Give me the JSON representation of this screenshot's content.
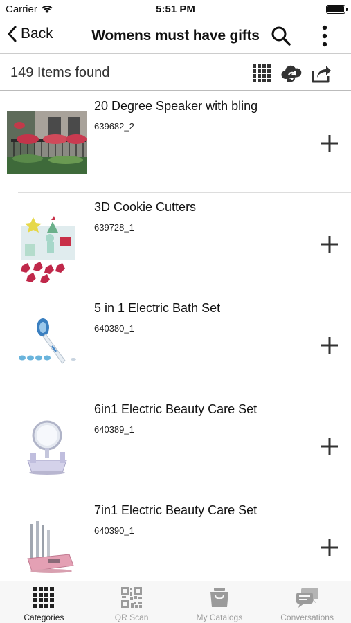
{
  "status_bar": {
    "carrier": "Carrier",
    "time": "5:51 PM"
  },
  "nav": {
    "back_label": "Back",
    "title": "Womens must have gifts"
  },
  "subheader": {
    "items_count": "149 Items found"
  },
  "items": [
    {
      "name": "20 Degree Speaker with bling",
      "sku": "639682_2"
    },
    {
      "name": "3D Cookie Cutters",
      "sku": "639728_1"
    },
    {
      "name": "5 in 1 Electric Bath Set",
      "sku": "640380_1"
    },
    {
      "name": "6in1 Electric Beauty Care Set",
      "sku": "640389_1"
    },
    {
      "name": "7in1 Electric Beauty Care Set",
      "sku": "640390_1"
    }
  ],
  "tabs": [
    {
      "label": "Categories",
      "icon": "grid-icon",
      "active": true
    },
    {
      "label": "QR Scan",
      "icon": "qr-code-icon",
      "active": false
    },
    {
      "label": "My Catalogs",
      "icon": "bag-icon",
      "active": false
    },
    {
      "label": "Conversations",
      "icon": "chat-bubbles-icon",
      "active": false
    }
  ],
  "colors": {
    "accent": "#222222",
    "inactive_tab": "#9b9b9b",
    "tab_bar_bg": "#f7f7f7"
  }
}
